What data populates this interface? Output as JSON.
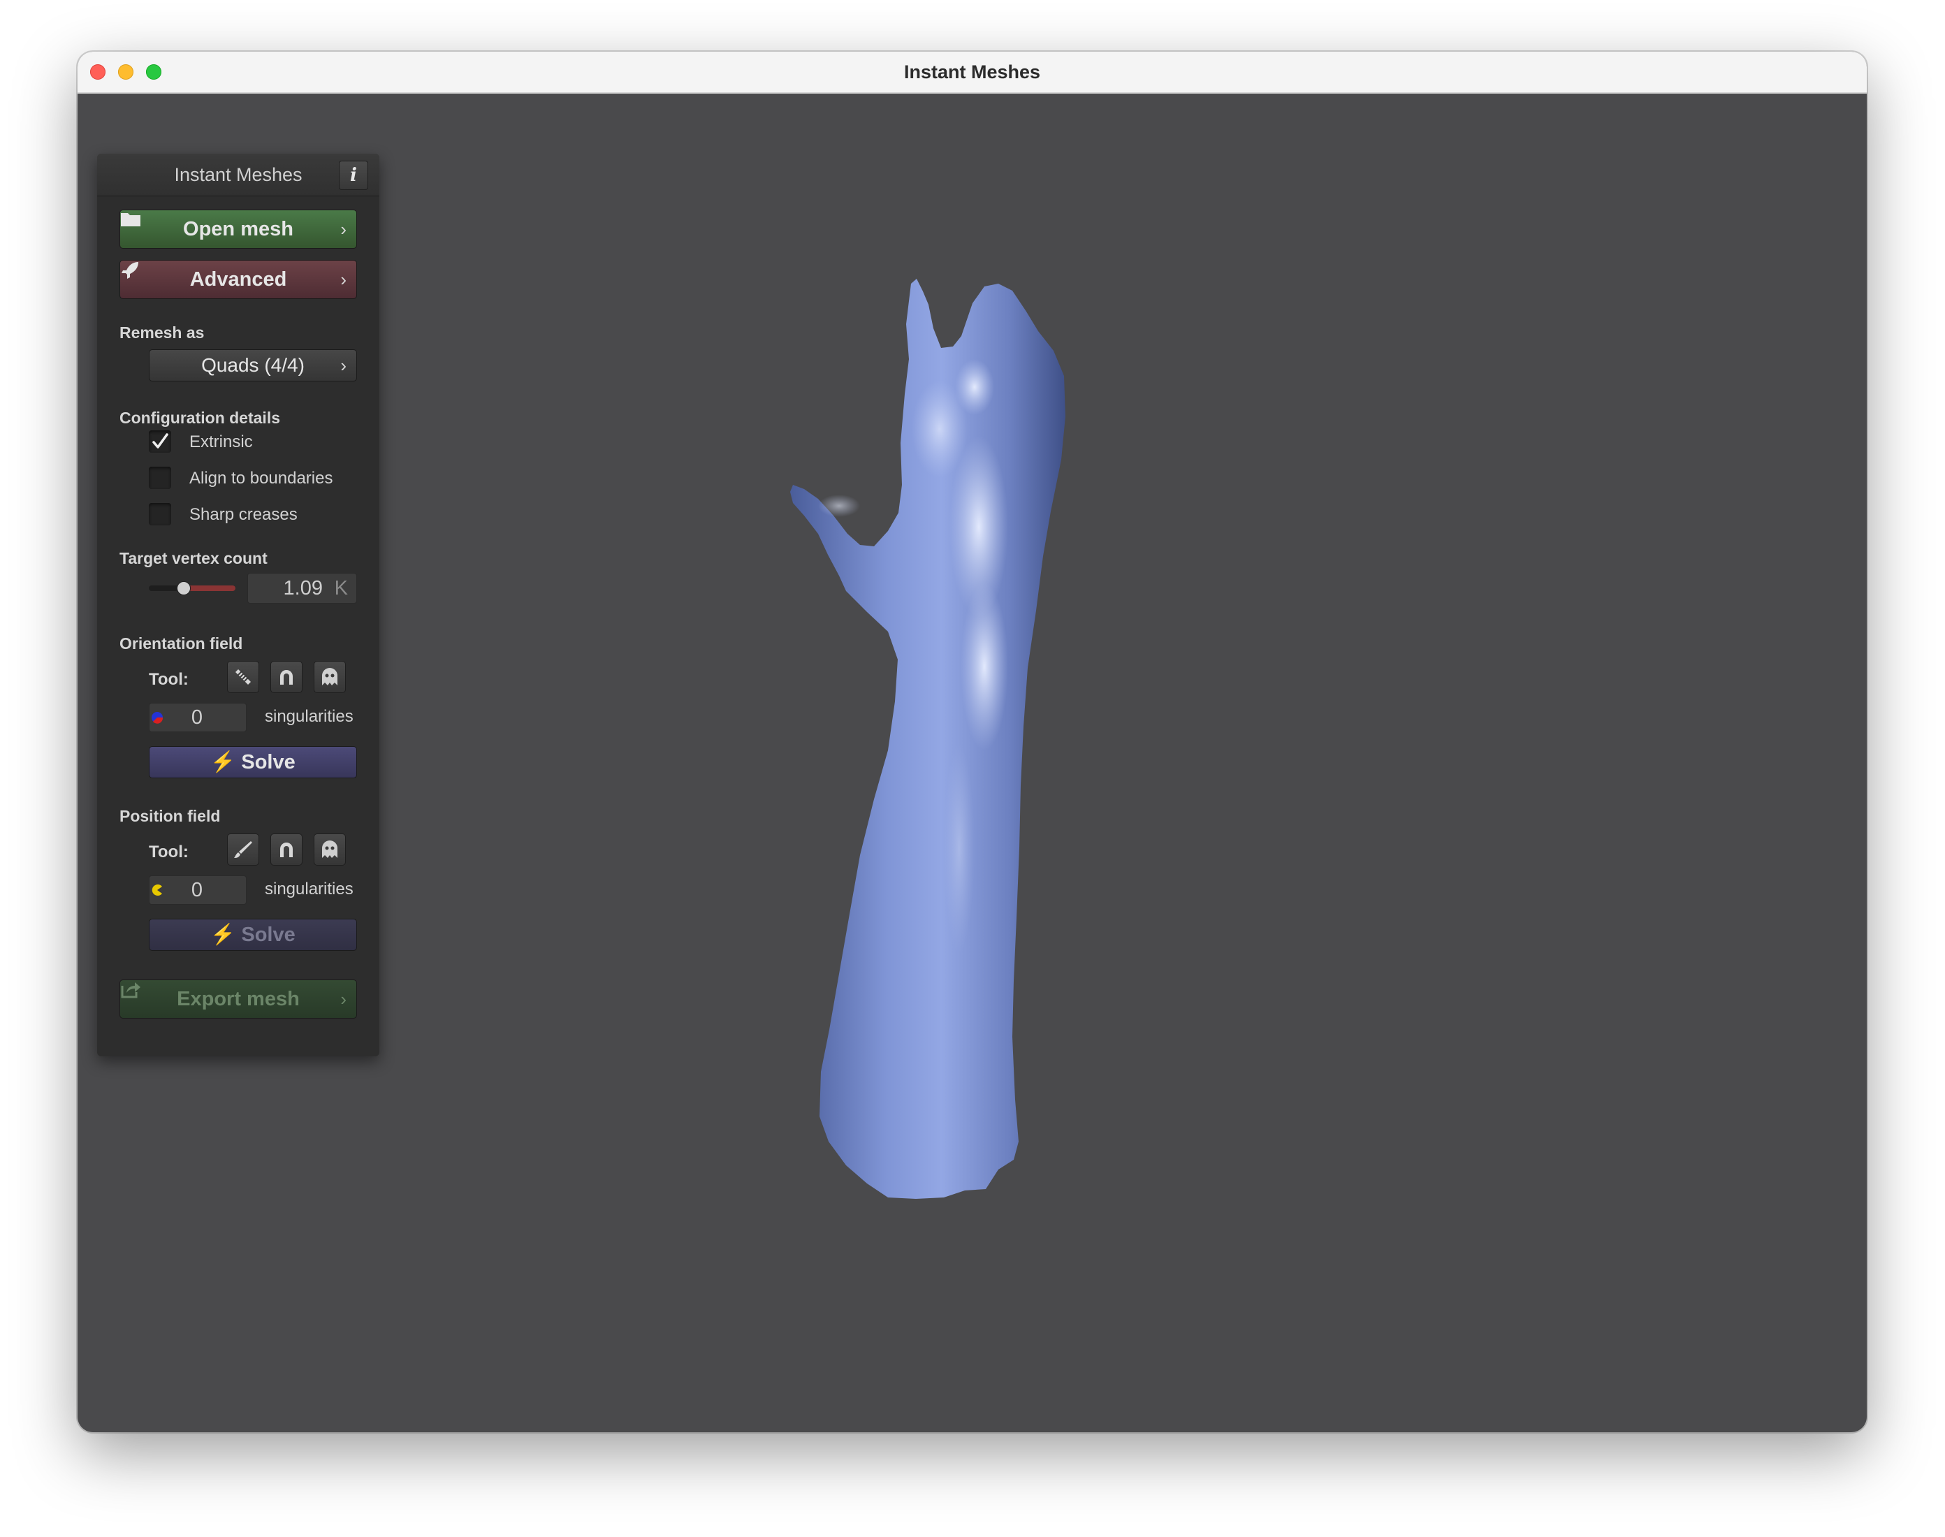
{
  "window": {
    "title": "Instant Meshes"
  },
  "colors": {
    "mesh": "#7a8fcc",
    "background": "#4a4a4c",
    "panel": "#2d2d2d"
  },
  "panel": {
    "title": "Instant Meshes",
    "info_label": "i",
    "open_mesh": {
      "label": "Open mesh",
      "icon": "folder-icon"
    },
    "advanced": {
      "label": "Advanced",
      "icon": "rocket-icon"
    },
    "remesh_as": {
      "heading": "Remesh as",
      "value": "Quads (4/4)"
    },
    "configuration": {
      "heading": "Configuration details",
      "options": [
        {
          "label": "Extrinsic",
          "checked": true
        },
        {
          "label": "Align to boundaries",
          "checked": false
        },
        {
          "label": "Sharp creases",
          "checked": false
        }
      ]
    },
    "target_vertex_count": {
      "heading": "Target vertex count",
      "value": "1.09",
      "unit": "K",
      "slider_fraction": 0.4
    },
    "orientation_field": {
      "heading": "Orientation field",
      "tool_label": "Tool:",
      "tools": [
        "comb-icon",
        "magnet-icon",
        "ghost-icon"
      ],
      "singularities_value": "0",
      "singularities_label": "singularities",
      "solve_label": "Solve"
    },
    "position_field": {
      "heading": "Position field",
      "tool_label": "Tool:",
      "tools": [
        "brush-icon",
        "magnet-icon",
        "ghost-icon"
      ],
      "singularities_value": "0",
      "singularities_label": "singularities",
      "solve_label": "Solve"
    },
    "export_mesh": {
      "label": "Export mesh",
      "icon": "export-icon"
    }
  }
}
